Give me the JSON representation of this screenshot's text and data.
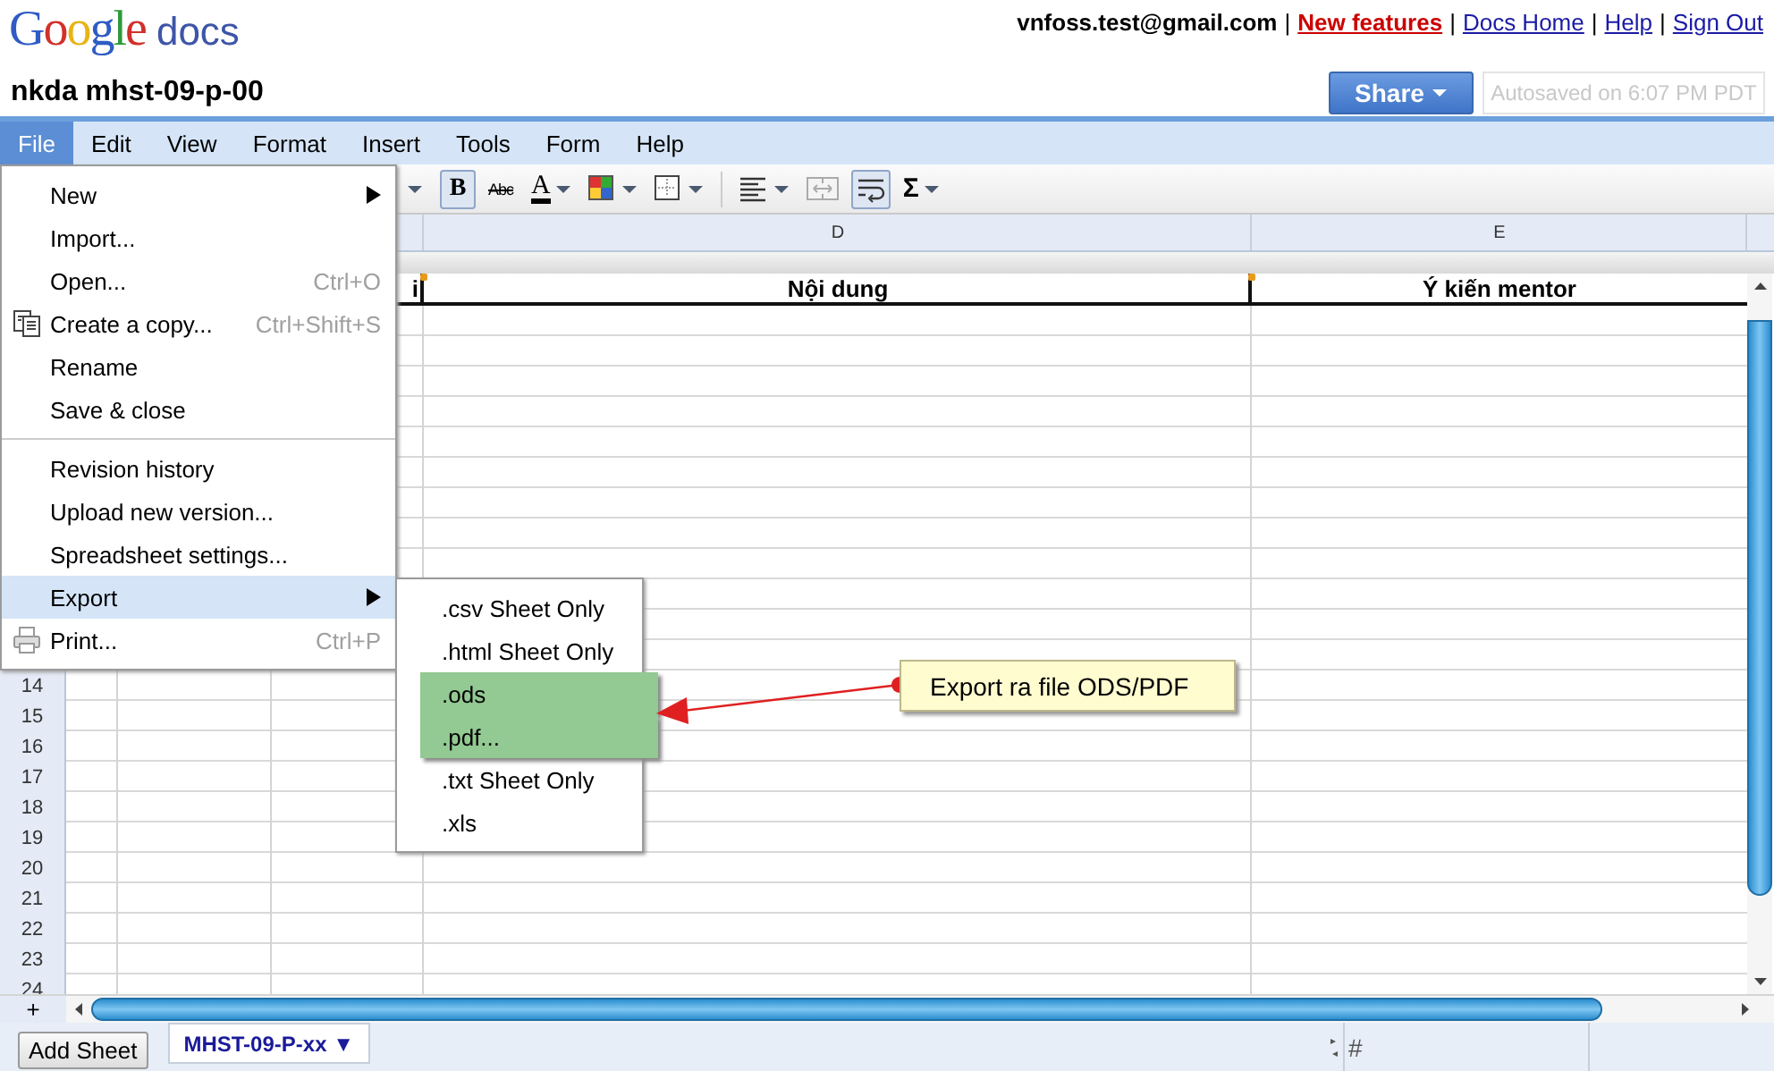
{
  "header": {
    "logo": {
      "brand": "Google",
      "product": "docs"
    },
    "account": "vnfoss.test@gmail.com",
    "links": [
      {
        "separator": "|",
        "label": "New features",
        "kind": "highlight"
      },
      {
        "separator": "|",
        "label": "Docs Home",
        "kind": "normal"
      },
      {
        "separator": "|",
        "label": "Help",
        "kind": "normal"
      },
      {
        "separator": "|",
        "label": "Sign Out",
        "kind": "normal"
      }
    ]
  },
  "document": {
    "title": "nkda mhst-09-p-00",
    "share_button": "Share",
    "autosave_status": "Autosaved on 6:07 PM PDT"
  },
  "menubar": [
    {
      "label": "File",
      "selected": true
    },
    {
      "label": "Edit",
      "selected": false
    },
    {
      "label": "View",
      "selected": false
    },
    {
      "label": "Format",
      "selected": false
    },
    {
      "label": "Insert",
      "selected": false
    },
    {
      "label": "Tools",
      "selected": false
    },
    {
      "label": "Form",
      "selected": false
    },
    {
      "label": "Help",
      "selected": false
    }
  ],
  "toolbar": [
    {
      "kind": "caret"
    },
    {
      "kind": "bold",
      "label": "B",
      "pressed": true,
      "dropdown": false
    },
    {
      "kind": "strikethrough",
      "label": "Abc",
      "pressed": false,
      "dropdown": false
    },
    {
      "kind": "text_color",
      "label": "A",
      "pressed": false,
      "dropdown": true
    },
    {
      "kind": "fill_color",
      "pressed": false,
      "dropdown": true
    },
    {
      "kind": "borders",
      "pressed": false,
      "dropdown": true
    },
    {
      "kind": "separator"
    },
    {
      "kind": "align",
      "pressed": false,
      "dropdown": true
    },
    {
      "kind": "merge",
      "pressed": false,
      "dropdown": false
    },
    {
      "kind": "wrap",
      "pressed": true,
      "dropdown": false
    },
    {
      "kind": "sum",
      "label": "Σ",
      "pressed": false,
      "dropdown": true
    }
  ],
  "sheet": {
    "columns": [
      {
        "label": "D"
      },
      {
        "label": "E"
      }
    ],
    "header_row": [
      {
        "text": "i",
        "has_note": true
      },
      {
        "text": "Nội dung",
        "has_note": true
      },
      {
        "text": "Ý kiến mentor",
        "has_note": false
      }
    ],
    "row_numbers": [
      "14",
      "15",
      "16",
      "17",
      "18",
      "19",
      "20",
      "21",
      "22",
      "23",
      "24"
    ],
    "add_row": "+"
  },
  "file_menu": {
    "items": [
      {
        "kind": "plain",
        "label": "New",
        "submenu": true,
        "highlighted": false,
        "separator_before": false
      },
      {
        "kind": "plain",
        "label": "Import...",
        "submenu": false,
        "highlighted": false,
        "separator_before": false
      },
      {
        "kind": "plain",
        "label": "Open...",
        "shortcut": "Ctrl+O",
        "submenu": false,
        "highlighted": false,
        "separator_before": false
      },
      {
        "kind": "copy",
        "label": "Create a copy...",
        "shortcut": "Ctrl+Shift+S",
        "submenu": false,
        "highlighted": false,
        "separator_before": false
      },
      {
        "kind": "plain",
        "label": "Rename",
        "submenu": false,
        "highlighted": false,
        "separator_before": false
      },
      {
        "kind": "plain",
        "label": "Save & close",
        "submenu": false,
        "highlighted": false,
        "separator_before": false
      },
      {
        "kind": "plain",
        "label": "Revision history",
        "submenu": false,
        "highlighted": false,
        "separator_before": true
      },
      {
        "kind": "plain",
        "label": "Upload new version...",
        "submenu": false,
        "highlighted": false,
        "separator_before": false
      },
      {
        "kind": "plain",
        "label": "Spreadsheet settings...",
        "submenu": false,
        "highlighted": false,
        "separator_before": false
      },
      {
        "kind": "plain",
        "label": "Export",
        "submenu": true,
        "highlighted": true,
        "separator_before": false
      },
      {
        "kind": "print",
        "label": "Print...",
        "shortcut": "Ctrl+P",
        "submenu": false,
        "highlighted": false,
        "separator_before": false
      }
    ]
  },
  "export_submenu": {
    "items": [
      {
        "label": ".csv Sheet Only",
        "annotated": false
      },
      {
        "label": ".html Sheet Only",
        "annotated": false
      },
      {
        "label": ".ods",
        "annotated": true
      },
      {
        "label": ".pdf...",
        "annotated": true
      },
      {
        "label": ".txt Sheet Only",
        "annotated": false
      },
      {
        "label": ".xls",
        "annotated": false
      }
    ]
  },
  "annotation": {
    "callout": "Export ra file ODS/PDF"
  },
  "bottom_bar": {
    "add_sheet": "Add Sheet",
    "sheet_tab": "MHST-09-P-xx ▼",
    "cell_reference": "#"
  }
}
